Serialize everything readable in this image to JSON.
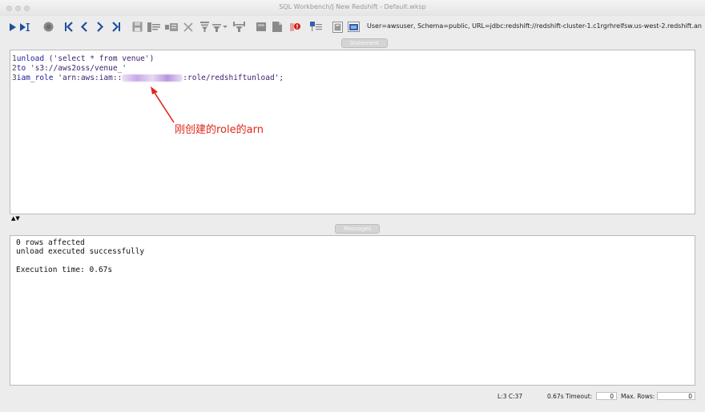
{
  "window": {
    "title": "SQL Workbench/J New Redshift - Default.wksp"
  },
  "toolbar": {
    "buttons": [
      {
        "name": "execute-current-button",
        "icon": "play-icon"
      },
      {
        "name": "execute-selected-button",
        "icon": "play-cursor-icon"
      },
      {
        "name": "stop-button",
        "icon": "stop-icon"
      },
      {
        "name": "first-row-button",
        "icon": "first-icon"
      },
      {
        "name": "previous-row-button",
        "icon": "previous-icon"
      },
      {
        "name": "next-row-button",
        "icon": "next-icon"
      },
      {
        "name": "last-row-button",
        "icon": "last-icon"
      },
      {
        "name": "save-button",
        "icon": "save-icon"
      },
      {
        "name": "insert-row-button",
        "icon": "insert-row-icon"
      },
      {
        "name": "copy-row-button",
        "icon": "copy-row-icon"
      },
      {
        "name": "delete-row-button",
        "icon": "delete-icon"
      },
      {
        "name": "filter-button",
        "icon": "filter-icon"
      },
      {
        "name": "filter-dropdown-button",
        "icon": "filter-dropdown-icon"
      },
      {
        "name": "filter-selection-button",
        "icon": "filter-selection-icon"
      },
      {
        "name": "commit-button",
        "icon": "commit-icon"
      },
      {
        "name": "rollback-button",
        "icon": "rollback-icon"
      },
      {
        "name": "autocommit-button",
        "icon": "autocommit-icon"
      },
      {
        "name": "database-explorer-button",
        "icon": "explorer-icon"
      },
      {
        "name": "connection-info-button",
        "icon": "connection-icon"
      },
      {
        "name": "connect-button",
        "icon": "connect-icon"
      }
    ],
    "connection_info": "User=awsuser, Schema=public, URL=jdbc:redshift://redshift-cluster-1.c1rgrhrelfsw.us-west-2.redshift.an"
  },
  "editor": {
    "tab_label": "Statement",
    "lines": [
      {
        "num": "1",
        "kw": "unload",
        "rest": " ('select * from venue')"
      },
      {
        "num": "2",
        "kw": "to",
        "rest": " 's3://aws2oss/venue_'"
      },
      {
        "num": "3",
        "kw": "iam_role",
        "prefix": " 'arn:aws:iam::",
        "suffix": ":role/redshiftunload';"
      }
    ],
    "annotation": "刚创建的role的arn"
  },
  "messages": {
    "tab_label": "Messages",
    "lines": [
      "0 rows affected",
      "unload executed successfully",
      "",
      "Execution time: 0.67s"
    ]
  },
  "status": {
    "position": "L:3 C:37",
    "exec_time": "0.67s",
    "timeout_label": "Timeout:",
    "timeout_value": "0",
    "max_rows_label": "Max. Rows:",
    "max_rows_value": "0"
  },
  "colors": {
    "toolbar_icon": "#1f4f9e",
    "annotation": "#e0271c",
    "keyword": "#1a1a9c"
  }
}
